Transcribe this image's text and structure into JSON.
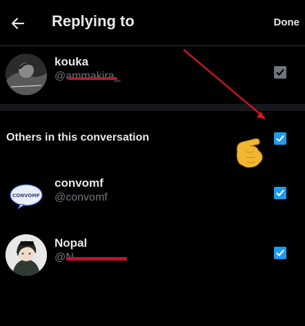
{
  "header": {
    "title": "Replying to",
    "done_label": "Done"
  },
  "primary_user": {
    "name": "kouka",
    "handle": "@ammakira_",
    "checked": true
  },
  "section": {
    "title": "Others in this conversation",
    "checked": true
  },
  "users": [
    {
      "name": "convomf",
      "handle": "@convomf",
      "avatar_text": "CONVOMF",
      "checked": true
    },
    {
      "name": "Nopal",
      "handle": "@N",
      "checked": true
    }
  ],
  "colors": {
    "accent": "#1d9bf0",
    "annotation": "#e0141e",
    "muted_checkbox": "#6e767d"
  },
  "icons": [
    "back-arrow-icon",
    "checkmark-icon",
    "pointing-hand-icon"
  ]
}
